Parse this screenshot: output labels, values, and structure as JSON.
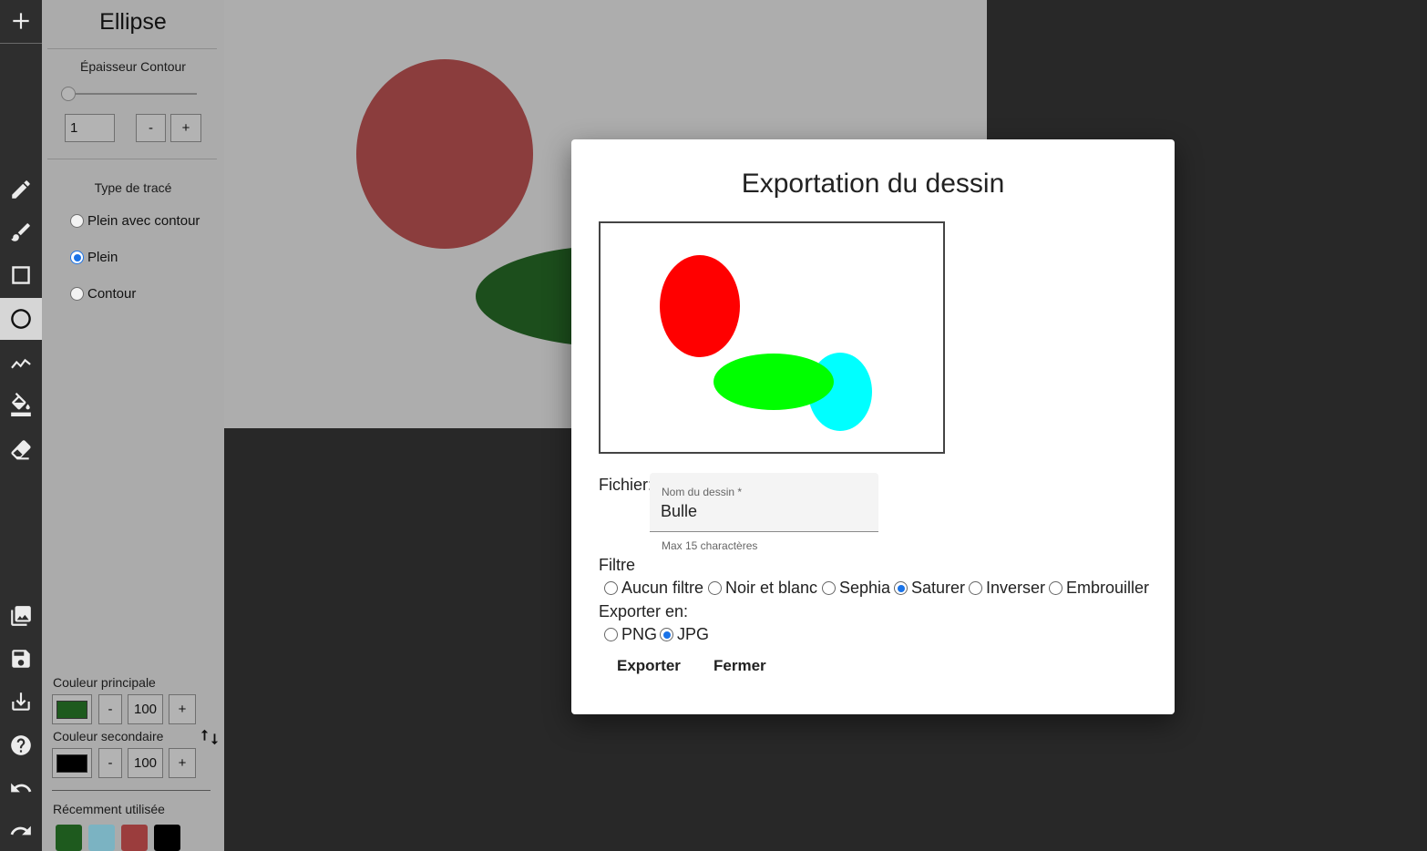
{
  "toolbar": {
    "icons": [
      "add-icon",
      "pencil-icon",
      "brush-icon",
      "rectangle-icon",
      "ellipse-icon",
      "polyline-icon",
      "paint-bucket-icon",
      "eraser-icon",
      "gallery-icon",
      "save-icon",
      "download-icon",
      "help-icon",
      "undo-icon",
      "redo-icon"
    ],
    "active_tool": "ellipse-icon"
  },
  "panel": {
    "title": "Ellipse",
    "stroke_width": {
      "label": "Épaisseur Contour",
      "value": "1",
      "minus": "-",
      "plus": "+",
      "slider_level": 0.0
    },
    "trace_type": {
      "label": "Type de tracé",
      "options": [
        "Plein avec contour",
        "Plein",
        "Contour"
      ],
      "selected": "Plein"
    },
    "primary_color": {
      "label": "Couleur principale",
      "color": "#1e5a1e",
      "minus": "-",
      "opacity": "100",
      "plus": "+"
    },
    "secondary_color": {
      "label": "Couleur secondaire",
      "color": "#000000",
      "minus": "-",
      "opacity": "100",
      "plus": "+"
    },
    "recent": {
      "label": "Récemment utilisée",
      "colors": [
        "#1e5a1e",
        "#7bb3c2",
        "#9b3d3d",
        "#000000"
      ]
    }
  },
  "canvas": {
    "background": "#adadad",
    "shapes": [
      {
        "kind": "ellipse",
        "color": "#8b3d3d"
      },
      {
        "kind": "ellipse",
        "color": "#1c4e1c"
      }
    ]
  },
  "export_dialog": {
    "title": "Exportation du dessin",
    "preview_shapes": [
      {
        "kind": "ellipse",
        "color": "#ff0000"
      },
      {
        "kind": "ellipse",
        "color": "#00ffff"
      },
      {
        "kind": "ellipse",
        "color": "#00ff00"
      }
    ],
    "file_label": "Fichier:",
    "name_field": {
      "label": "Nom du dessin *",
      "value": "Bulle",
      "hint": "Max 15 charactères"
    },
    "filter_label": "Filtre",
    "filters": [
      "Aucun filtre",
      "Noir et blanc",
      "Sephia",
      "Saturer",
      "Inverser",
      "Embrouiller"
    ],
    "selected_filter": "Saturer",
    "format_label": "Exporter en:",
    "formats": [
      "PNG",
      "JPG"
    ],
    "selected_format": "JPG",
    "export_button": "Exporter",
    "close_button": "Fermer"
  }
}
